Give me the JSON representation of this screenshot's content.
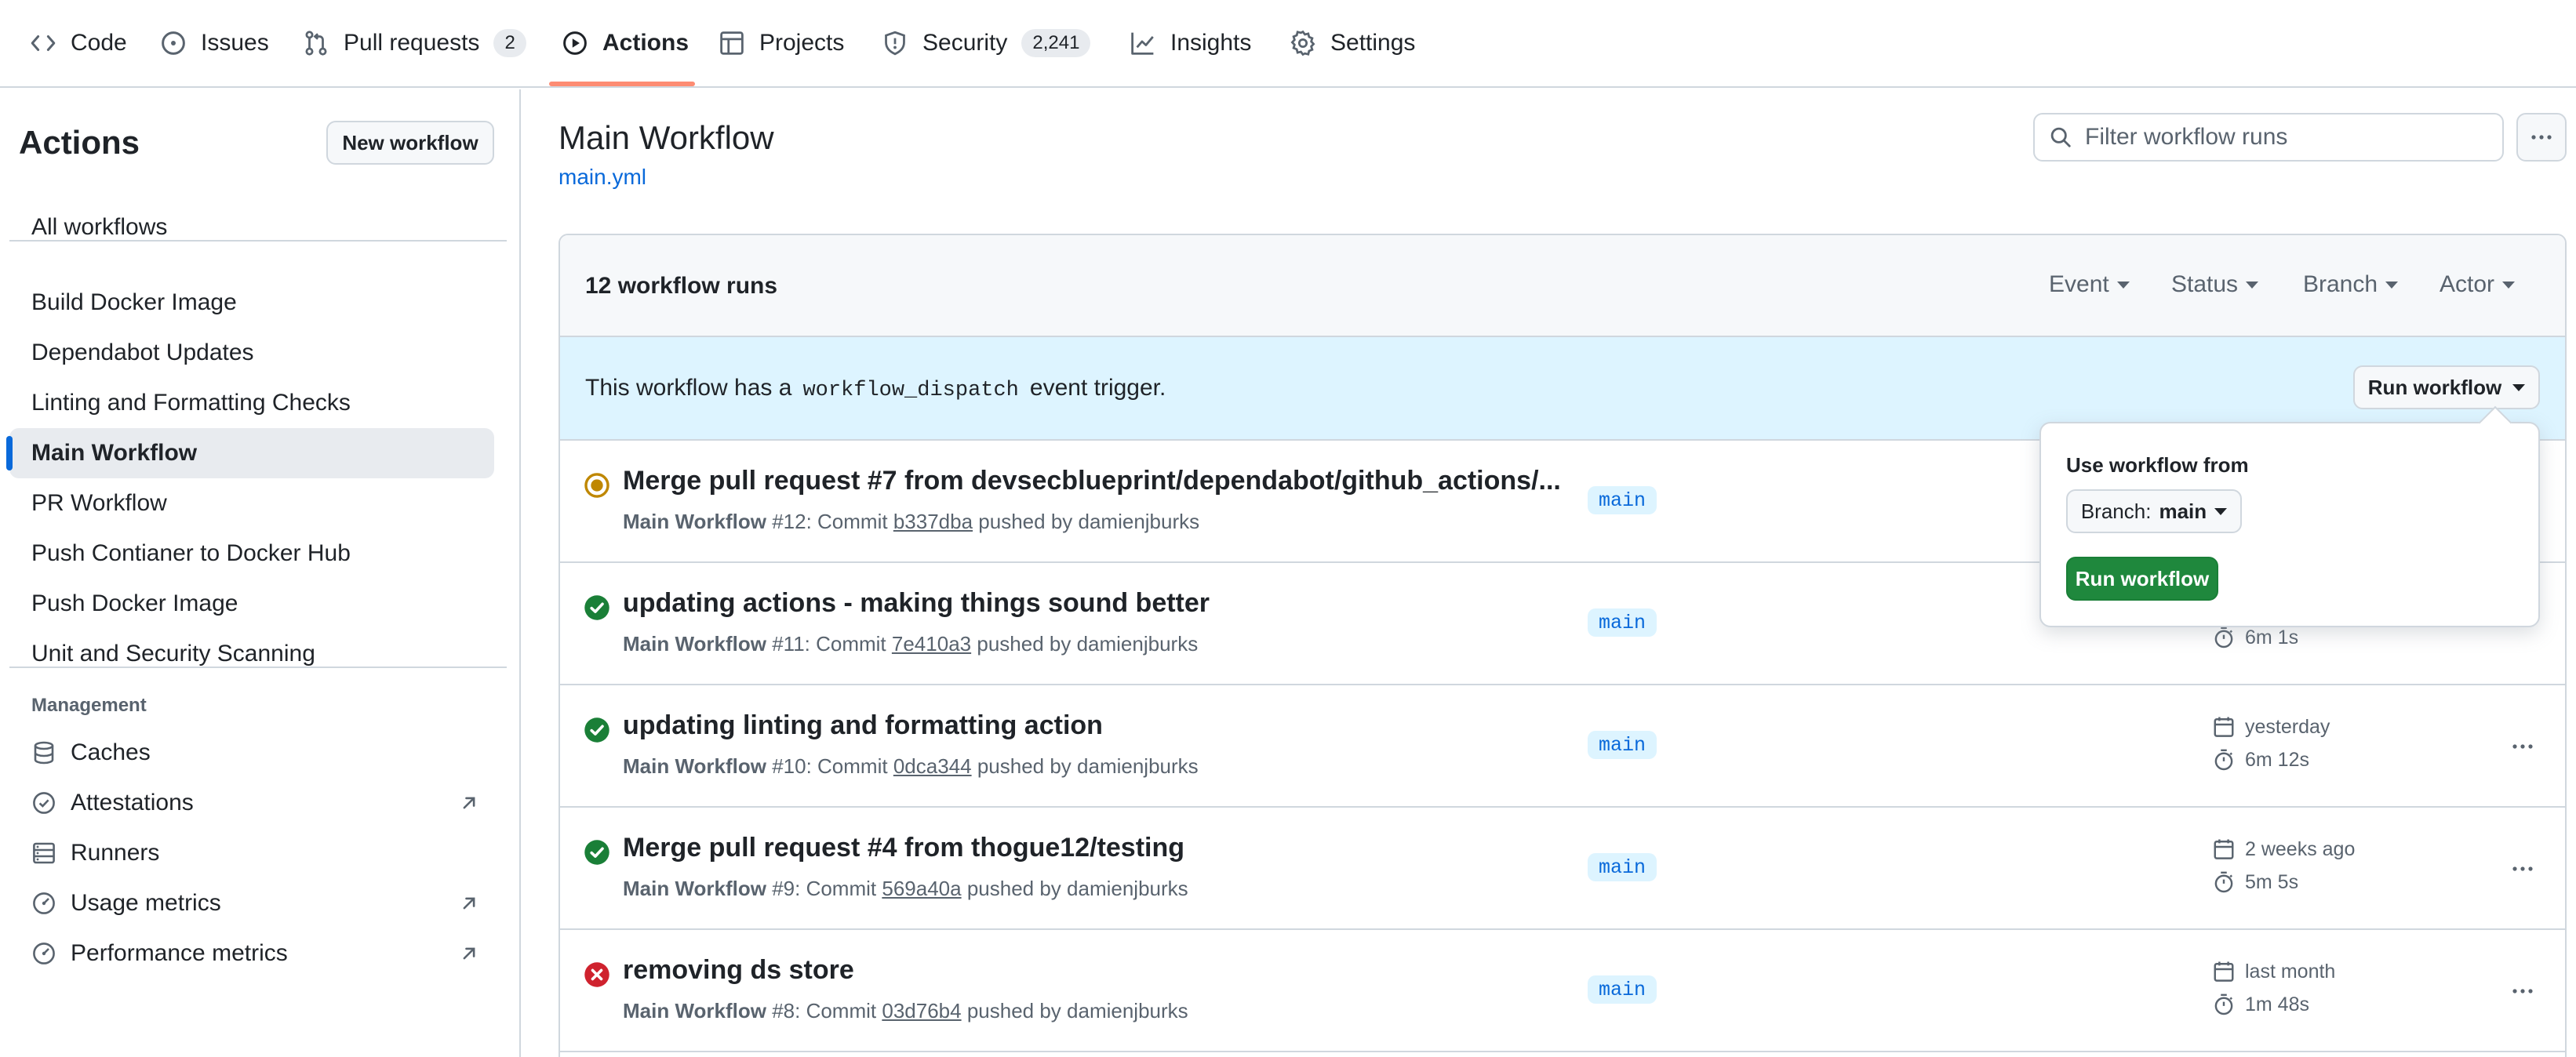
{
  "nav": {
    "tabs": [
      {
        "label": "Code",
        "icon": "code-icon"
      },
      {
        "label": "Issues",
        "icon": "issue-icon"
      },
      {
        "label": "Pull requests",
        "icon": "pull-request-icon",
        "count": "2"
      },
      {
        "label": "Actions",
        "icon": "play-icon",
        "active": true
      },
      {
        "label": "Projects",
        "icon": "table-icon"
      },
      {
        "label": "Security",
        "icon": "shield-icon",
        "count": "2,241"
      },
      {
        "label": "Insights",
        "icon": "graph-icon"
      },
      {
        "label": "Settings",
        "icon": "gear-icon"
      }
    ]
  },
  "sidebar": {
    "title": "Actions",
    "new_workflow_label": "New workflow",
    "all_workflows": "All workflows",
    "workflows": [
      {
        "label": "Build Docker Image"
      },
      {
        "label": "Dependabot Updates"
      },
      {
        "label": "Linting and Formatting Checks"
      },
      {
        "label": "Main Workflow",
        "active": true
      },
      {
        "label": "PR Workflow"
      },
      {
        "label": "Push Contianer to Docker Hub"
      },
      {
        "label": "Push Docker Image"
      },
      {
        "label": "Unit and Security Scanning"
      }
    ],
    "management_heading": "Management",
    "management": [
      {
        "label": "Caches",
        "icon": "database-icon",
        "external": false
      },
      {
        "label": "Attestations",
        "icon": "verified-icon",
        "external": true
      },
      {
        "label": "Runners",
        "icon": "server-icon",
        "external": false
      },
      {
        "label": "Usage metrics",
        "icon": "meter-icon",
        "external": true
      },
      {
        "label": "Performance metrics",
        "icon": "meter-icon",
        "external": true
      }
    ]
  },
  "main": {
    "title": "Main Workflow",
    "file": "main.yml",
    "filter_placeholder": "Filter workflow runs",
    "runs_count": "12 workflow runs",
    "filters": [
      "Event",
      "Status",
      "Branch",
      "Actor"
    ],
    "dispatch": {
      "prefix": "This workflow has a",
      "code": "workflow_dispatch",
      "suffix": "event trigger.",
      "button": "Run workflow"
    },
    "popover": {
      "label": "Use workflow from",
      "branch_prefix": "Branch:",
      "branch_value": "main",
      "run_button": "Run workflow"
    },
    "runs": [
      {
        "status": "in-progress",
        "title": "Merge pull request #7 from devsecblueprint/dependabot/github_actions/...",
        "workflow": "Main Workflow",
        "number": "#12: Commit",
        "sha": "b337dba",
        "by": "pushed by damienjburks",
        "branch": "main",
        "time": "",
        "duration": ""
      },
      {
        "status": "success",
        "title": "updating actions - making things sound better",
        "workflow": "Main Workflow",
        "number": "#11: Commit",
        "sha": "7e410a3",
        "by": "pushed by damienjburks",
        "branch": "main",
        "time": "",
        "duration": "6m 1s"
      },
      {
        "status": "success",
        "title": "updating linting and formatting action",
        "workflow": "Main Workflow",
        "number": "#10: Commit",
        "sha": "0dca344",
        "by": "pushed by damienjburks",
        "branch": "main",
        "time": "yesterday",
        "duration": "6m 12s"
      },
      {
        "status": "success",
        "title": "Merge pull request #4 from thogue12/testing",
        "workflow": "Main Workflow",
        "number": "#9: Commit",
        "sha": "569a40a",
        "by": "pushed by damienjburks",
        "branch": "main",
        "time": "2 weeks ago",
        "duration": "5m 5s"
      },
      {
        "status": "failure",
        "title": "removing ds store",
        "workflow": "Main Workflow",
        "number": "#8: Commit",
        "sha": "03d76b4",
        "by": "pushed by damienjburks",
        "branch": "main",
        "time": "last month",
        "duration": "1m 48s"
      }
    ]
  },
  "colors": {
    "accent_underline": "#fd8c73",
    "link": "#0969da",
    "success": "#1a7f37",
    "failure": "#cf222e",
    "in_progress": "#bf8700",
    "run_button": "#1f883d",
    "banner": "#ddf4ff"
  }
}
